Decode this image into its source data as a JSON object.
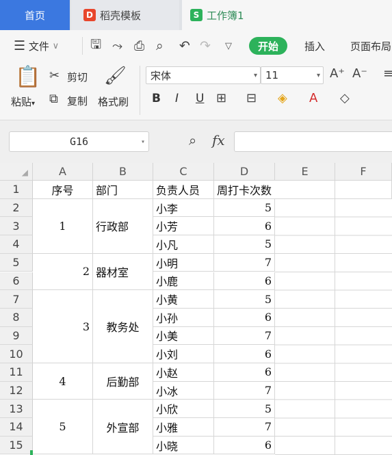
{
  "tabs": {
    "home": "首页",
    "template": "稻壳模板",
    "workbook": "工作簿1"
  },
  "menu": {
    "file": "文件",
    "start": "开始",
    "insert": "插入",
    "page_layout": "页面布局"
  },
  "ribbon": {
    "paste": "粘贴",
    "cut": "剪切",
    "copy": "复制",
    "format_painter": "格式刷",
    "font_name": "宋体",
    "font_size": "11",
    "bold": "B",
    "italic": "I",
    "underline": "U"
  },
  "formula_bar": {
    "name_box": "G16",
    "fx": "fx",
    "formula": ""
  },
  "columns": [
    "A",
    "B",
    "C",
    "D",
    "E",
    "F"
  ],
  "rows": [
    "1",
    "2",
    "3",
    "4",
    "5",
    "6",
    "7",
    "8",
    "9",
    "10",
    "11",
    "12",
    "13",
    "14",
    "15"
  ],
  "header": {
    "seq": "序号",
    "dept": "部门",
    "person": "负责人员",
    "count": "周打卡次数"
  },
  "groups": [
    {
      "seq": "1",
      "dept": "行政部"
    },
    {
      "seq": "2",
      "dept": "器材室"
    },
    {
      "seq": "3",
      "dept": "教务处"
    },
    {
      "seq": "4",
      "dept": "后勤部"
    },
    {
      "seq": "5",
      "dept": "外宣部"
    }
  ],
  "people": [
    {
      "name": "小李",
      "count": "5"
    },
    {
      "name": "小芳",
      "count": "6"
    },
    {
      "name": "小凡",
      "count": "5"
    },
    {
      "name": "小明",
      "count": "7"
    },
    {
      "name": "小鹿",
      "count": "6"
    },
    {
      "name": "小黄",
      "count": "5"
    },
    {
      "name": "小孙",
      "count": "6"
    },
    {
      "name": "小美",
      "count": "7"
    },
    {
      "name": "小刘",
      "count": "6"
    },
    {
      "name": "小赵",
      "count": "6"
    },
    {
      "name": "小冰",
      "count": "7"
    },
    {
      "name": "小欣",
      "count": "5"
    },
    {
      "name": "小雅",
      "count": "7"
    },
    {
      "name": "小晓",
      "count": "6"
    }
  ]
}
